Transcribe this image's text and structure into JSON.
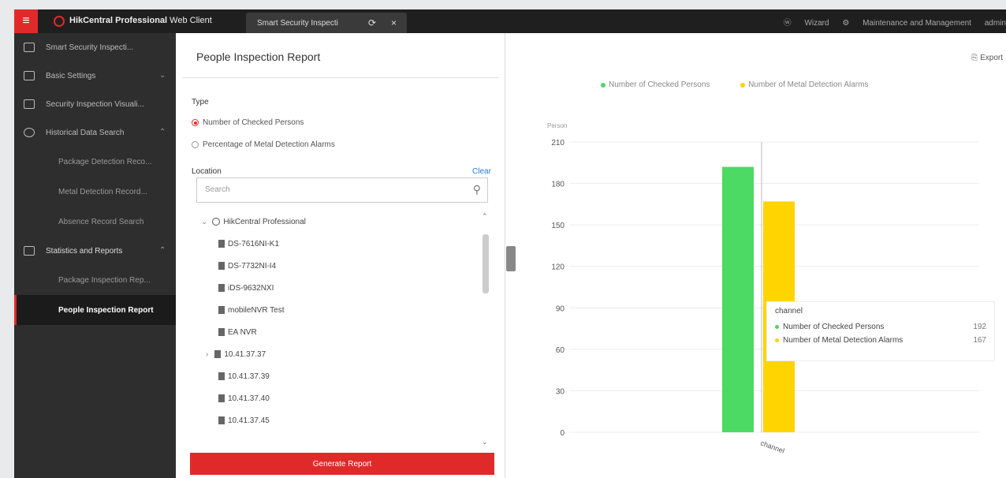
{
  "topbar": {
    "app_name": "HikCentral Professional",
    "app_suffix": "Web Client",
    "tab_label": "Smart Security Inspecti",
    "wizard": "Wizard",
    "maintenance": "Maintenance and Management",
    "user": "admin"
  },
  "sidebar": {
    "items": [
      {
        "label": "Smart Security Inspecti...",
        "icon": "list-icon"
      },
      {
        "label": "Basic Settings",
        "icon": "settings-icon"
      },
      {
        "label": "Security Inspection Visuali...",
        "icon": "monitor-icon"
      },
      {
        "label": "Historical Data Search",
        "icon": "search-icon"
      },
      {
        "label": "Statistics and Reports",
        "icon": "chart-icon"
      }
    ],
    "search_subitems": [
      "Package Detection Reco...",
      "Metal Detection Record...",
      "Absence Record Search"
    ],
    "report_subitems": [
      "Package Inspection Rep...",
      "People Inspection Report"
    ]
  },
  "panel": {
    "title": "People Inspection Report",
    "type_label": "Type",
    "type_options": [
      "Number of Checked Persons",
      "Percentage of Metal Detection Alarms"
    ],
    "location_label": "Location",
    "clear_label": "Clear",
    "search_placeholder": "Search",
    "tree_root": "HikCentral Professional",
    "tree_items": [
      "DS-7616NI-K1",
      "DS-7732NI-I4",
      "iDS-9632NXI",
      "mobileNVR Test",
      "EA NVR",
      "10.41.37.37",
      "10.41.37.39",
      "10.41.37.40",
      "10.41.37.45"
    ],
    "generate_label": "Generate Report"
  },
  "chart": {
    "export_label": "Export",
    "tooltip_title": "channel"
  },
  "colors": {
    "accent": "#e02a2a",
    "green": "#4cd964",
    "yellow": "#ffd400"
  },
  "chart_data": {
    "type": "bar",
    "categories": [
      "channel"
    ],
    "series": [
      {
        "name": "Number of Checked Persons",
        "values": [
          192
        ]
      },
      {
        "name": "Number of Metal Detection Alarms",
        "values": [
          167
        ]
      }
    ],
    "ylabel": "Person",
    "ylim": [
      0,
      210
    ],
    "yticks": [
      0,
      30,
      60,
      90,
      120,
      150,
      180,
      210
    ],
    "legend": "top",
    "grid": true
  }
}
